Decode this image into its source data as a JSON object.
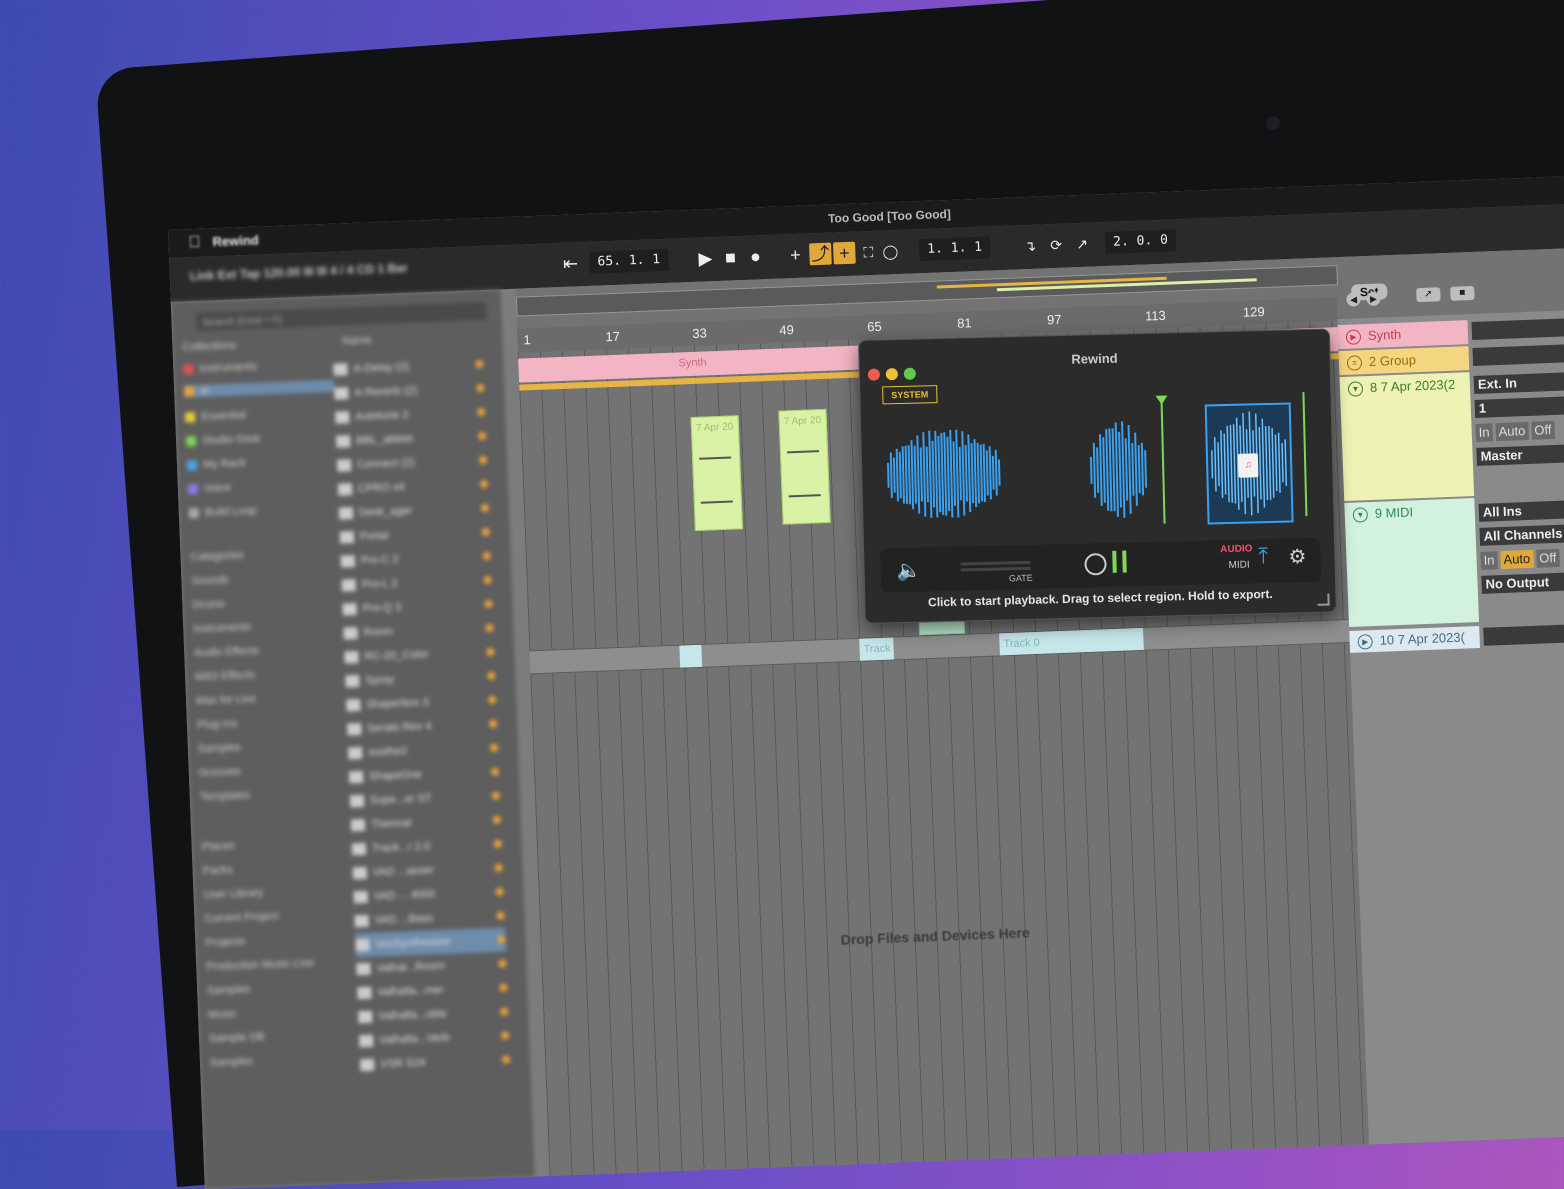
{
  "window": {
    "app_name": "Rewind",
    "title": "Too Good [Too Good]"
  },
  "transport": {
    "blurred_controls": "Link Ext Tap 120.00 III III 4 / 4 CD 1 Bar",
    "arrangement_position": "65. 1. 1",
    "song_position": "1. 1. 1",
    "loop_length": "2. 0. 0"
  },
  "browser": {
    "search_placeholder": "Search (Cmd + F)",
    "collections": [
      "Collections",
      "Instruments",
      "ai",
      "Essential",
      "Studio Gear",
      "My Rack",
      "Voice",
      "Build Loop"
    ],
    "categories": [
      "Categories",
      "Sounds",
      "Drums",
      "Instruments",
      "Audio Effects",
      "MIDI Effects",
      "Max for Live",
      "Plug-Ins",
      "Samples",
      "Grooves",
      "Templates"
    ],
    "places": [
      "Places",
      "Packs",
      "User Library",
      "Current Project",
      "Projects",
      "Production Music Live",
      "Samples",
      "Music",
      "Sample DB",
      "Samples"
    ],
    "files_header": "Name",
    "files": [
      "A-Delay (2)",
      "A-Reverb (2)",
      "Autotune 2",
      "BBL_ableto",
      "Connect (2)",
      "CPRO x4",
      "Desk_ager",
      "Portal",
      "Pro-C 2",
      "Pro-L 2",
      "Pro-Q 3",
      "Room",
      "RC-20_Color",
      "Spray",
      "Shaperbox 3",
      "Serato Rev 4",
      "soothe2",
      "ShapeOne",
      "Supe...er ST",
      "Thermal",
      "Track...r 2.0",
      "VAD ...asser",
      "VAD ... 4000",
      "VAD ...Bass",
      "VoxSynthesizer",
      "Valhal...Room",
      "Valhalla...mer",
      "Valhalla...uble",
      "Valhalla...Verb",
      "VSR S24"
    ]
  },
  "ruler": {
    "bars": [
      "1",
      "17",
      "33",
      "49",
      "65",
      "81",
      "97",
      "113",
      "129"
    ],
    "set_label": "Set"
  },
  "arrangement": {
    "synth_clip": "Synth",
    "midi_clip_1": "7 Apr 20",
    "midi_clip_2": "7 Apr 20",
    "track_clip_1": "Track",
    "track_clip_2": "Track 0",
    "drop_text": "Drop Files and Devices Here"
  },
  "tracks": [
    {
      "name": "Synth",
      "color": "#f3b5c3",
      "text_color": "#c23b5a",
      "icon": "play-icon"
    },
    {
      "name": "2 Group",
      "color": "#f4d681",
      "text_color": "#9c6b00",
      "icon": "group-icon"
    },
    {
      "name": "8 7 Apr 2023(2",
      "color": "#eef2b4",
      "text_color": "#3b7a35",
      "icon": "fold-icon"
    },
    {
      "name": "9 MIDI",
      "color": "#d2f1df",
      "text_color": "#2e8a5a",
      "icon": "fold-icon"
    },
    {
      "name": "10 7 Apr 2023(",
      "color": "#dde9ef",
      "text_color": "#3e6e86",
      "icon": "play-icon"
    }
  ],
  "io": {
    "audio_input": "Ext. In",
    "audio_channel": "1",
    "audio_monitor": [
      "In",
      "Auto",
      "Off"
    ],
    "audio_output": "Master",
    "midi_input": "All Ins",
    "midi_channel": "All Channels",
    "midi_monitor": [
      "In",
      "Auto",
      "Off"
    ],
    "midi_output": "No Output"
  },
  "plugin": {
    "title": "Rewind",
    "mode_badge": "SYSTEM",
    "gate_label": "GATE",
    "audio_label": "AUDIO",
    "midi_label": "MIDI",
    "hint": "Click to start playback. Drag to select region. Hold to export.",
    "accent": "#3aa0f0",
    "traffic_lights": [
      "#ee5b52",
      "#f0bf3a",
      "#5fcb48"
    ]
  }
}
